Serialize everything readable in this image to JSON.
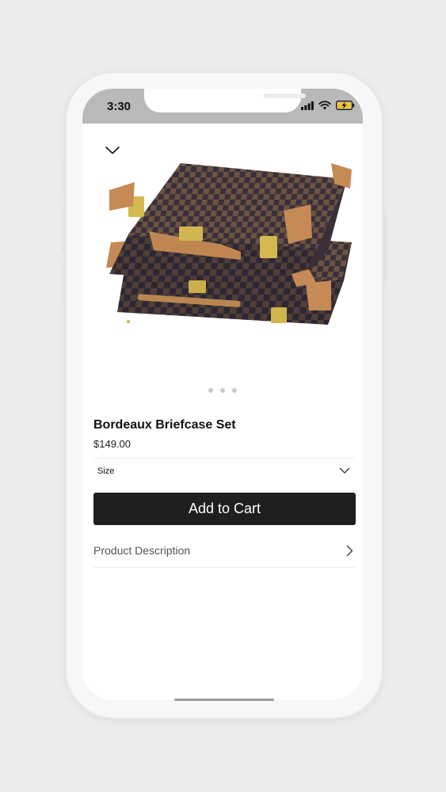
{
  "status_bar": {
    "time": "3:30"
  },
  "product": {
    "title": "Bordeaux Briefcase Set",
    "price": "$149.00",
    "image_description": "Stacked checkered brown leather briefcases",
    "gallery_page_count": 3
  },
  "options": {
    "size_label": "Size"
  },
  "actions": {
    "add_to_cart_label": "Add to Cart"
  },
  "sections": {
    "description_label": "Product Description"
  },
  "icons": {
    "close": "chevron-down-icon",
    "size_dropdown": "chevron-down-icon",
    "description": "chevron-right-icon",
    "signal": "cellular-signal-icon",
    "wifi": "wifi-icon",
    "battery": "battery-charging-icon"
  },
  "colors": {
    "button_bg": "#1f1f21",
    "status_bar_bg": "#b9b9bb",
    "battery_fill": "#f3c623"
  }
}
